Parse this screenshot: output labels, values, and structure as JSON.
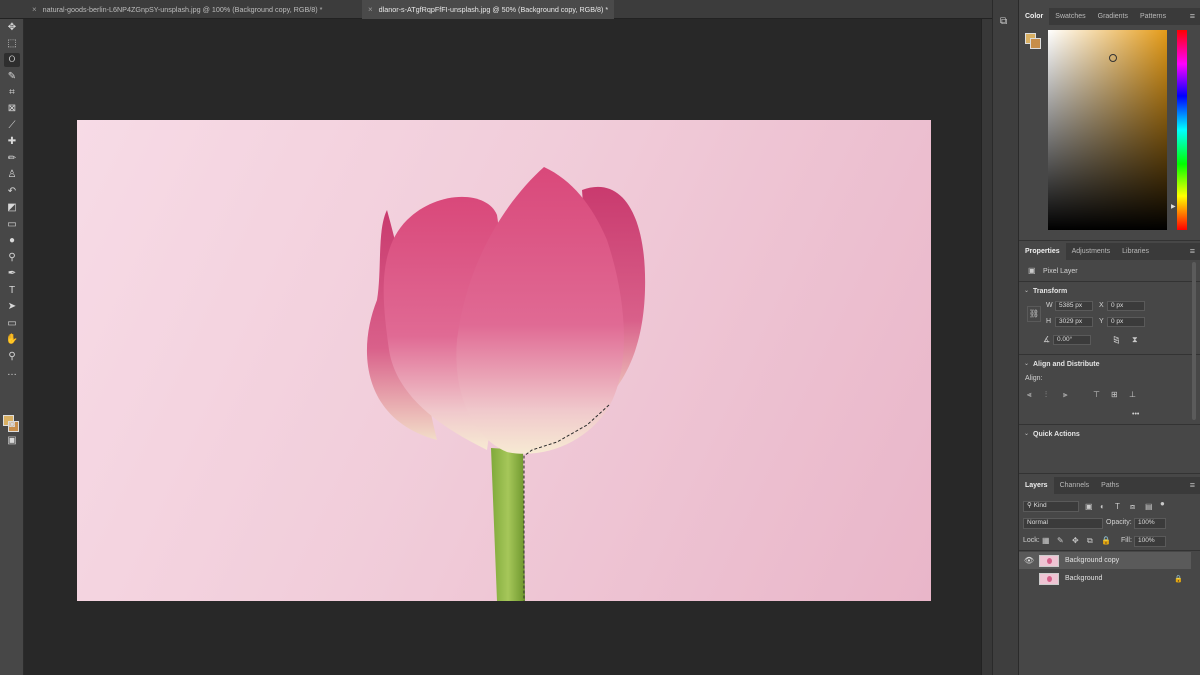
{
  "tabs": [
    {
      "label": "natural-goods-berlin-L6NP4ZGnpSY-unsplash.jpg @ 100% (Background copy, RGB/8) *",
      "active": false
    },
    {
      "label": "dlanor-s-ATgfRqpFfFI-unsplash.jpg @ 50% (Background copy, RGB/8) *",
      "active": true
    }
  ],
  "tab_close_glyph": "×",
  "toolbar": {
    "tools": [
      "move-tool-icon",
      "marquee-tool-icon",
      "lasso-tool-icon",
      "quick-select-tool-icon",
      "crop-tool-icon",
      "frame-tool-icon",
      "eyedropper-tool-icon",
      "healing-brush-icon",
      "brush-tool-icon",
      "clone-stamp-icon",
      "history-brush-icon",
      "eraser-tool-icon",
      "gradient-tool-icon",
      "blur-tool-icon",
      "dodge-tool-icon",
      "pen-tool-icon",
      "type-tool-icon",
      "path-select-icon",
      "rectangle-tool-icon",
      "hand-tool-icon",
      "zoom-tool-icon",
      "more-tools-icon"
    ],
    "foreground_color": "#d9b063",
    "background_color": "#c88e4a"
  },
  "color_panel": {
    "tabs": [
      "Color",
      "Swatches",
      "Gradients",
      "Patterns"
    ],
    "active_tab": "Color",
    "hue_color": "#e49b18"
  },
  "properties": {
    "tabs": [
      "Properties",
      "Adjustments",
      "Libraries"
    ],
    "layer_type": "Pixel Layer",
    "transform_title": "Transform",
    "w_label": "W",
    "w_value": "5385 px",
    "h_label": "H",
    "h_value": "3029 px",
    "x_label": "X",
    "x_value": "0 px",
    "y_label": "Y",
    "y_value": "0 px",
    "angle_value": "0.00°",
    "align_title": "Align and Distribute",
    "align_label": "Align:",
    "quick_actions_title": "Quick Actions",
    "more_glyph": "•••"
  },
  "layers_panel": {
    "tabs": [
      "Layers",
      "Channels",
      "Paths"
    ],
    "filter_kind": "Kind",
    "blend_mode": "Normal",
    "opacity_label": "Opacity:",
    "opacity_value": "100%",
    "lock_label": "Lock:",
    "fill_label": "Fill:",
    "fill_value": "100%",
    "layers": [
      {
        "name": "Background copy",
        "visible": true,
        "selected": true,
        "locked": false
      },
      {
        "name": "Background",
        "visible": false,
        "selected": false,
        "locked": true
      }
    ]
  },
  "canvas": {
    "background_from": "#f7dbe6",
    "background_to": "#e9b6c9"
  }
}
